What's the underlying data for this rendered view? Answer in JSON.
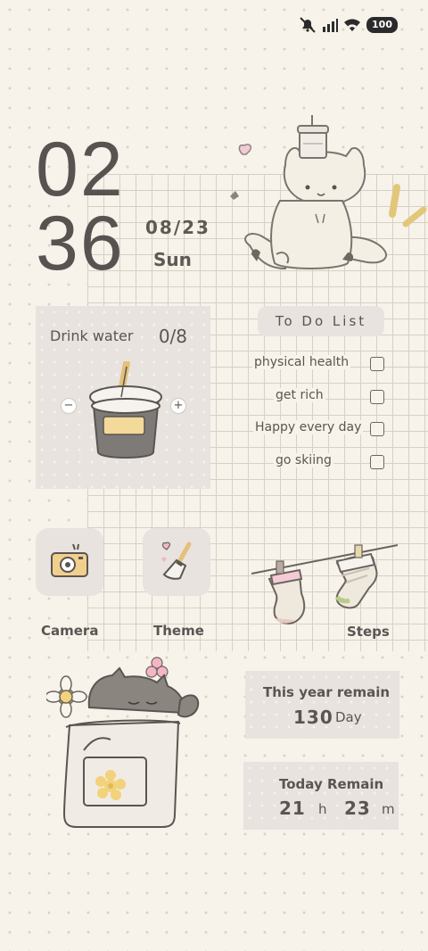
{
  "status_bar": {
    "battery": "100"
  },
  "clock": {
    "hour": "02",
    "minute": "36",
    "date": "08/23",
    "weekday": "Sun"
  },
  "water": {
    "label": "Drink water",
    "count": "0/8",
    "minus": "−",
    "plus": "+"
  },
  "todo": {
    "title": "To Do List",
    "items": [
      "physical health",
      "get rich",
      "Happy every day",
      "go skiing"
    ]
  },
  "apps": {
    "camera": "Camera",
    "theme": "Theme",
    "steps": "Steps"
  },
  "year_remain": {
    "title": "This year remain",
    "value": "130",
    "unit": "Day"
  },
  "today_remain": {
    "title": "Today Remain",
    "hours": "21",
    "h": "h",
    "minutes": "23",
    "m": "m"
  }
}
